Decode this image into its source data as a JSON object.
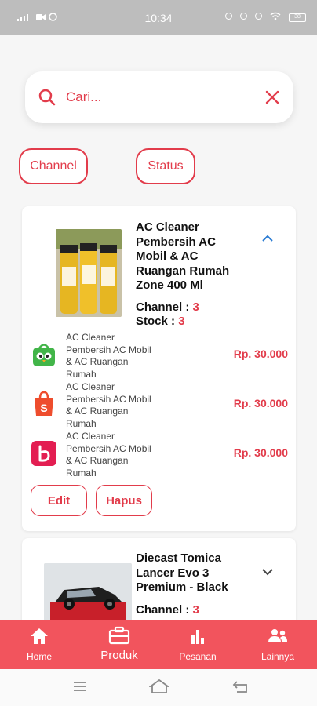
{
  "status_bar": {
    "time": "10:34",
    "battery": "38"
  },
  "search": {
    "placeholder": "Cari..."
  },
  "filters": {
    "channel_label": "Channel",
    "status_label": "Status"
  },
  "products": [
    {
      "title": "AC Cleaner Pembersih AC Mobil & AC Ruangan Rumah Zone 400 Ml",
      "channel_label": "Channel : ",
      "channel_value": "3",
      "stock_label": "Stock : ",
      "stock_value": "3",
      "channels": [
        {
          "store": "tokopedia-logo",
          "name": "AC Cleaner Pembersih AC Mobil & AC Ruangan Rumah",
          "price": "Rp. 30.000"
        },
        {
          "store": "shopee-logo",
          "name": "AC Cleaner Pembersih AC Mobil & AC Ruangan Rumah",
          "price": "Rp. 30.000"
        },
        {
          "store": "bukalapak-logo",
          "name": "AC Cleaner Pembersih AC Mobil & AC Ruangan Rumah",
          "price": "Rp. 30.000"
        }
      ],
      "edit_label": "Edit",
      "delete_label": "Hapus"
    },
    {
      "title": "Diecast Tomica Lancer Evo 3 Premium - Black",
      "channel_label": "Channel : ",
      "channel_value": "3"
    }
  ],
  "bottom_nav": [
    {
      "label": "Home",
      "icon": "home-icon"
    },
    {
      "label": "Produk",
      "icon": "briefcase-icon",
      "active": true
    },
    {
      "label": "Pesanan",
      "icon": "bar-chart-icon"
    },
    {
      "label": "Lainnya",
      "icon": "people-icon"
    }
  ],
  "colors": {
    "accent": "#e23c4b",
    "nav_background": "#f2545d",
    "status_bar": "#bdbdbd"
  }
}
